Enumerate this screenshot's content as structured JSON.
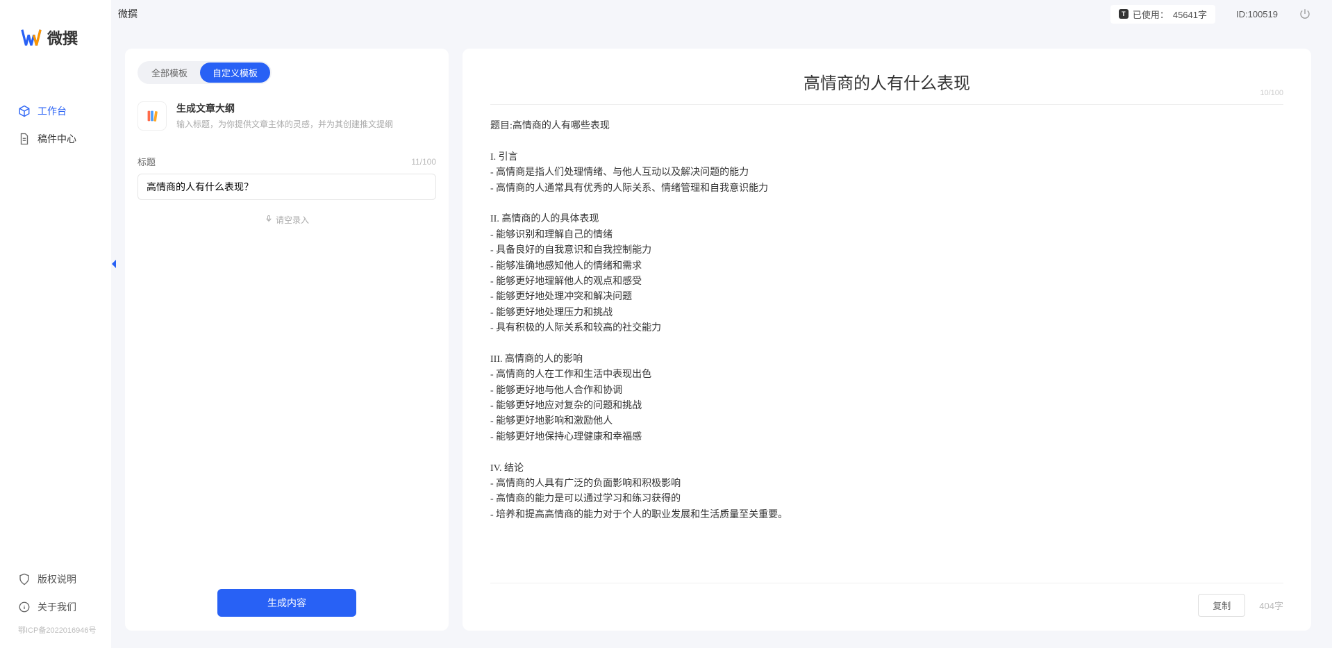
{
  "app": {
    "name": "微撰",
    "header_title": "微撰"
  },
  "header": {
    "usage_label": "已使用：",
    "usage_value": "45641字",
    "user_id": "ID:100519"
  },
  "sidebar": {
    "nav": [
      {
        "label": "工作台",
        "icon": "cube"
      },
      {
        "label": "稿件中心",
        "icon": "document"
      }
    ],
    "bottom": [
      {
        "label": "版权说明",
        "icon": "shield"
      },
      {
        "label": "关于我们",
        "icon": "info"
      }
    ],
    "footer": "鄂ICP备2022016946号"
  },
  "left_panel": {
    "tabs": [
      {
        "label": "全部模板",
        "active": false
      },
      {
        "label": "自定义模板",
        "active": true
      }
    ],
    "template": {
      "title": "生成文章大纲",
      "desc": "输入标题，为你提供文章主体的灵感，并为其创建推文提纲"
    },
    "form": {
      "title_label": "标题",
      "char_count": "11/100",
      "title_value": "高情商的人有什么表现？",
      "voice_hint": "请空录入"
    },
    "generate_btn": "生成内容"
  },
  "output": {
    "title": "高情商的人有什么表现",
    "title_counter": "10/100",
    "content": "题目:高情商的人有哪些表现\n\nI. 引言\n- 高情商是指人们处理情绪、与他人互动以及解决问题的能力\n- 高情商的人通常具有优秀的人际关系、情绪管理和自我意识能力\n\nII. 高情商的人的具体表现\n- 能够识别和理解自己的情绪\n- 具备良好的自我意识和自我控制能力\n- 能够准确地感知他人的情绪和需求\n- 能够更好地理解他人的观点和感受\n- 能够更好地处理冲突和解决问题\n- 能够更好地处理压力和挑战\n- 具有积极的人际关系和较高的社交能力\n\nIII. 高情商的人的影响\n- 高情商的人在工作和生活中表现出色\n- 能够更好地与他人合作和协调\n- 能够更好地应对复杂的问题和挑战\n- 能够更好地影响和激励他人\n- 能够更好地保持心理健康和幸福感\n\nIV. 结论\n- 高情商的人具有广泛的负面影响和积极影响\n- 高情商的能力是可以通过学习和练习获得的\n- 培养和提高高情商的能力对于个人的职业发展和生活质量至关重要。",
    "copy_btn": "复制",
    "word_count": "404字"
  }
}
